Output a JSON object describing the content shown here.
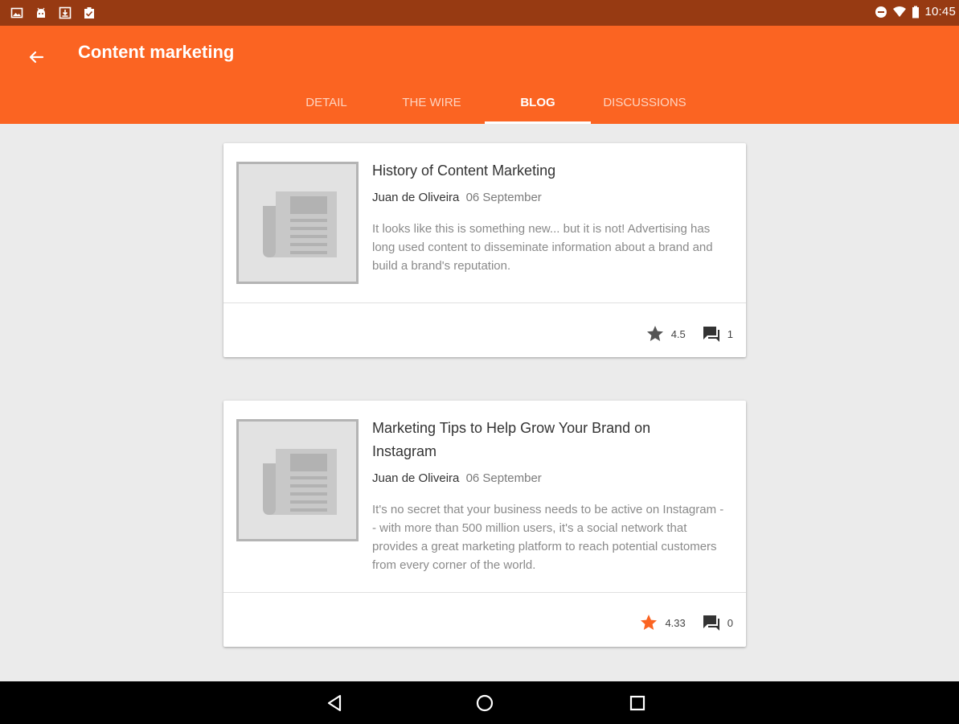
{
  "status_bar": {
    "time": "10:45",
    "left_icons": [
      "image-icon",
      "android-icon",
      "download-icon",
      "clipboard-check-icon"
    ],
    "right_icons": [
      "do-not-disturb-icon",
      "wifi-icon",
      "battery-icon"
    ]
  },
  "app_bar": {
    "title": "Content marketing",
    "color": "#fb6422",
    "status_color": "#973a12"
  },
  "tabs": [
    {
      "label": "DETAIL",
      "active": false
    },
    {
      "label": "THE WIRE",
      "active": false
    },
    {
      "label": "BLOG",
      "active": true
    },
    {
      "label": "DISCUSSIONS",
      "active": false
    }
  ],
  "posts": [
    {
      "title": "History of Content Marketing",
      "author": "Juan de Oliveira",
      "date": "06 September",
      "excerpt": "It looks like this is something new... but it is not! Advertising has long used content to disseminate information about a brand and build a brand's reputation.",
      "rating": "4.5",
      "comments": "1",
      "star_color": "#555555"
    },
    {
      "title": "Marketing Tips to Help Grow Your Brand on Instagram",
      "author": "Juan de Oliveira",
      "date": "06 September",
      "excerpt": "It's no secret that your business needs to be active on Instagram -- with more than 500 million users, it's a social network that provides a great marketing platform to reach potential customers from every corner of the world.",
      "rating": "4.33",
      "comments": "0",
      "star_color": "#fb6422"
    }
  ],
  "nav_bar": {
    "buttons": [
      "back-triangle-icon",
      "home-circle-icon",
      "recents-square-icon"
    ]
  }
}
